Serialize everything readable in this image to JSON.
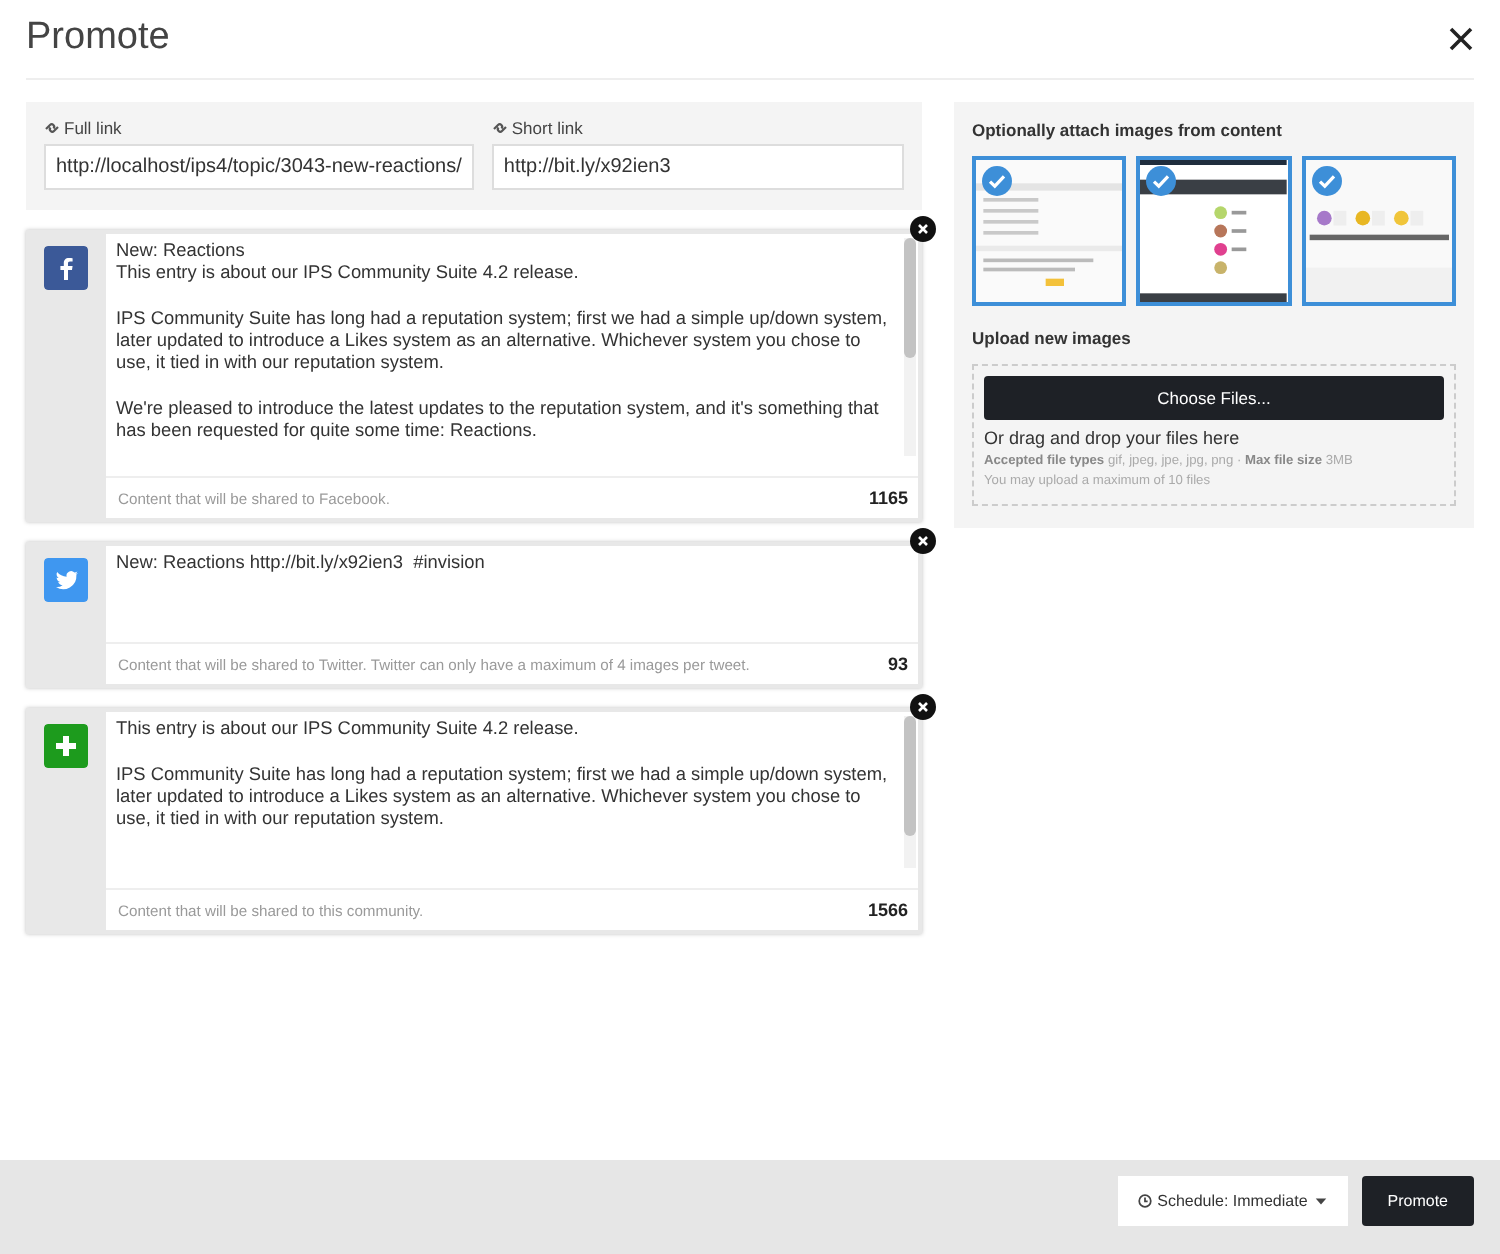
{
  "dialog": {
    "title": "Promote"
  },
  "links": [
    {
      "label": "Full link",
      "value": "http://localhost/ips4/topic/3043-new-reactions/"
    },
    {
      "label": "Short link",
      "value": "http://bit.ly/x92ien3"
    }
  ],
  "shares": [
    {
      "kind": "facebook",
      "text": "New: Reactions\nThis entry is about our IPS Community Suite 4.2 release.\n\nIPS Community Suite has long had a reputation system; first we had a simple up/down system, later updated to introduce a Likes system as an alternative. Whichever system you chose to use, it tied in with our reputation system.\n\nWe're pleased to introduce the latest updates to the reputation system, and it's something that has been requested for quite some time: Reactions.",
      "hint": "Content that will be shared to Facebook.",
      "count": "1165",
      "scrollbar": true
    },
    {
      "kind": "twitter",
      "text": "New: Reactions http://bit.ly/x92ien3  #invision",
      "hint": "Content that will be shared to Twitter. Twitter can only have a maximum of 4 images per tweet.",
      "count": "93",
      "scrollbar": false
    },
    {
      "kind": "community",
      "text": "This entry is about our IPS Community Suite 4.2 release.\n\nIPS Community Suite has long had a reputation system; first we had a simple up/down system, later updated to introduce a Likes system as an alternative. Whichever system you chose to use, it tied in with our reputation system.",
      "hint": "Content that will be shared to this community.",
      "count": "1566",
      "scrollbar": true
    }
  ],
  "attach": {
    "title": "Optionally attach images from content",
    "images": [
      {
        "selected": true
      },
      {
        "selected": true
      },
      {
        "selected": true
      }
    ]
  },
  "upload": {
    "title": "Upload new images",
    "button": "Choose Files...",
    "drop": "Or drag and drop your files here",
    "types": "**Accepted file types** gif, jpeg, jpe, jpg, png · **Max file size** 3MB",
    "limit": "You may upload a maximum of 10 files"
  },
  "footer": {
    "schedule": "Schedule: Immediate",
    "promote": "Promote"
  }
}
